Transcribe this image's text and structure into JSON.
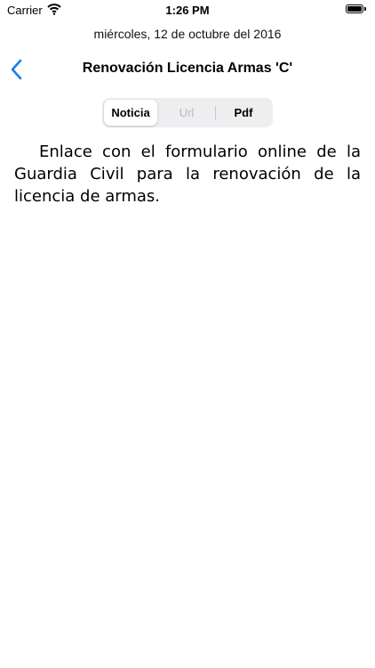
{
  "status_bar": {
    "carrier": "Carrier",
    "time": "1:26 PM"
  },
  "date": "miércoles, 12 de octubre del 2016",
  "nav": {
    "title": "Renovación Licencia Armas 'C'",
    "back_icon": "chevron-left-icon"
  },
  "segments": [
    {
      "label": "Noticia",
      "state": "selected"
    },
    {
      "label": "Url",
      "state": "disabled"
    },
    {
      "label": "Pdf",
      "state": "enabled"
    }
  ],
  "article": {
    "text": "Enlace con el formulario online de la Guardia Civil para la renovación de la licencia de armas."
  },
  "colors": {
    "accent": "#1a7cf0",
    "segment_background": "#eeeef0",
    "disabled_text": "#b8b8bd"
  }
}
